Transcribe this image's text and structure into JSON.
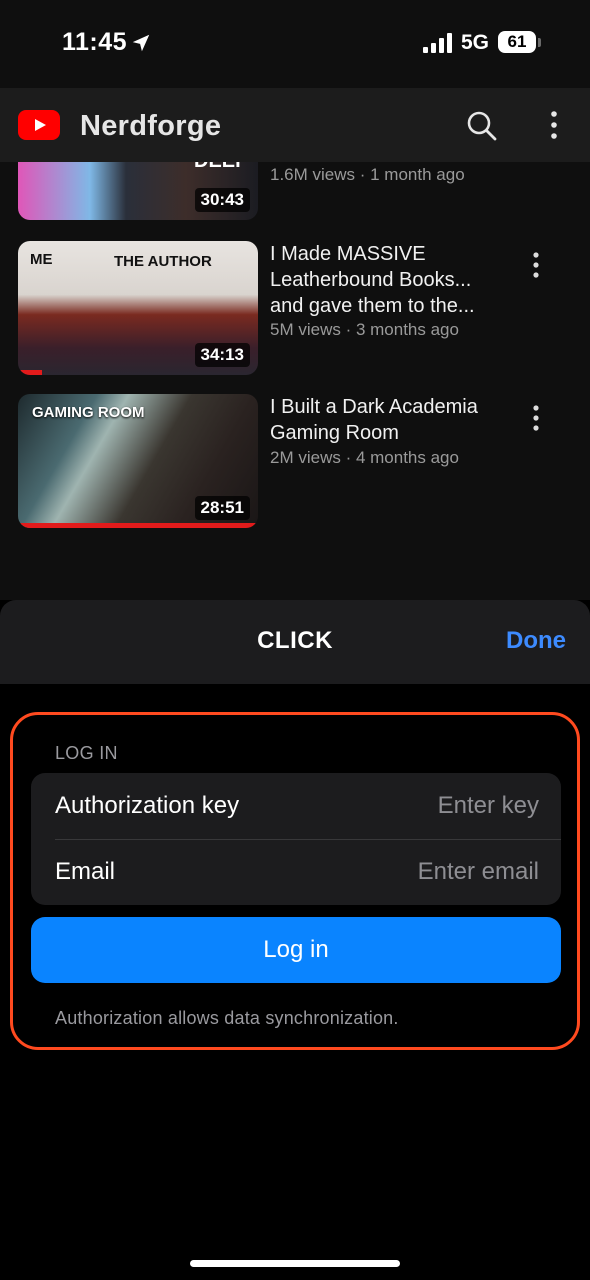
{
  "status_bar": {
    "time": "11:45",
    "network": "5G",
    "battery": "61"
  },
  "header": {
    "channel_name": "Nerdforge"
  },
  "videos": [
    {
      "title": "",
      "views": "1.6M views · 1 month ago",
      "duration": "30:43",
      "thumb_text": "DEEP",
      "progress": 0.0
    },
    {
      "title": "I Made MASSIVE Leatherbound Books... and gave them to the...",
      "views": "5M views · 3 months ago",
      "duration": "34:13",
      "thumb_labels": [
        "ME",
        "THE AUTHOR"
      ],
      "progress": 0.1
    },
    {
      "title": "I Built a Dark Academia Gaming Room",
      "views": "2M views · 4 months ago",
      "duration": "28:51",
      "thumb_labels": [
        "GAMING ROOM"
      ],
      "progress": 1.0
    }
  ],
  "sheet": {
    "title": "CLICK",
    "done_label": "Done"
  },
  "login": {
    "section_label": "LOG IN",
    "key_label": "Authorization key",
    "key_placeholder": "Enter key",
    "email_label": "Email",
    "email_placeholder": "Enter email",
    "button_label": "Log in",
    "footnote": "Authorization allows data synchronization."
  },
  "colors": {
    "accent": "#0a84ff",
    "done": "#3d8bff",
    "highlight": "#ff4a1f",
    "progress": "#e21b1b"
  }
}
